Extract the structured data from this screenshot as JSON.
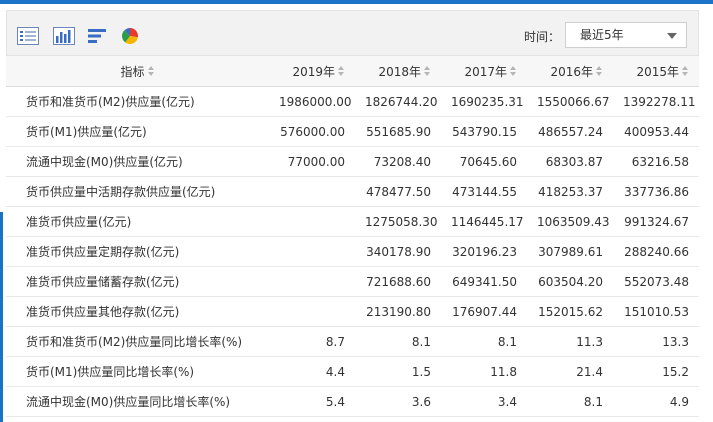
{
  "toolbar": {
    "icons": [
      "list-view-icon",
      "bar-chart-icon",
      "text-align-icon",
      "pie-chart-icon"
    ],
    "time_label": "时间：",
    "time_select_value": "最近5年"
  },
  "table": {
    "headers": [
      "指标",
      "2019年",
      "2018年",
      "2017年",
      "2016年",
      "2015年"
    ],
    "rows": [
      [
        "货币和准货币(M2)供应量(亿元)",
        "1986000.00",
        "1826744.20",
        "1690235.31",
        "1550066.67",
        "1392278.11"
      ],
      [
        "货币(M1)供应量(亿元)",
        "576000.00",
        "551685.90",
        "543790.15",
        "486557.24",
        "400953.44"
      ],
      [
        "流通中现金(M0)供应量(亿元)",
        "77000.00",
        "73208.40",
        "70645.60",
        "68303.87",
        "63216.58"
      ],
      [
        "货币供应量中活期存款供应量(亿元)",
        "",
        "478477.50",
        "473144.55",
        "418253.37",
        "337736.86"
      ],
      [
        "准货币供应量(亿元)",
        "",
        "1275058.30",
        "1146445.17",
        "1063509.43",
        "991324.67"
      ],
      [
        "准货币供应量定期存款(亿元)",
        "",
        "340178.90",
        "320196.23",
        "307989.61",
        "288240.66"
      ],
      [
        "准货币供应量储蓄存款(亿元)",
        "",
        "721688.60",
        "649341.50",
        "603504.20",
        "552073.48"
      ],
      [
        "准货币供应量其他存款(亿元)",
        "",
        "213190.80",
        "176907.44",
        "152015.62",
        "151010.53"
      ],
      [
        "货币和准货币(M2)供应量同比增长率(%)",
        "8.7",
        "8.1",
        "8.1",
        "11.3",
        "13.3"
      ],
      [
        "货币(M1)供应量同比增长率(%)",
        "4.4",
        "1.5",
        "11.8",
        "21.4",
        "15.2"
      ],
      [
        "流通中现金(M0)供应量同比增长率(%)",
        "5.4",
        "3.6",
        "3.4",
        "8.1",
        "4.9"
      ]
    ]
  }
}
